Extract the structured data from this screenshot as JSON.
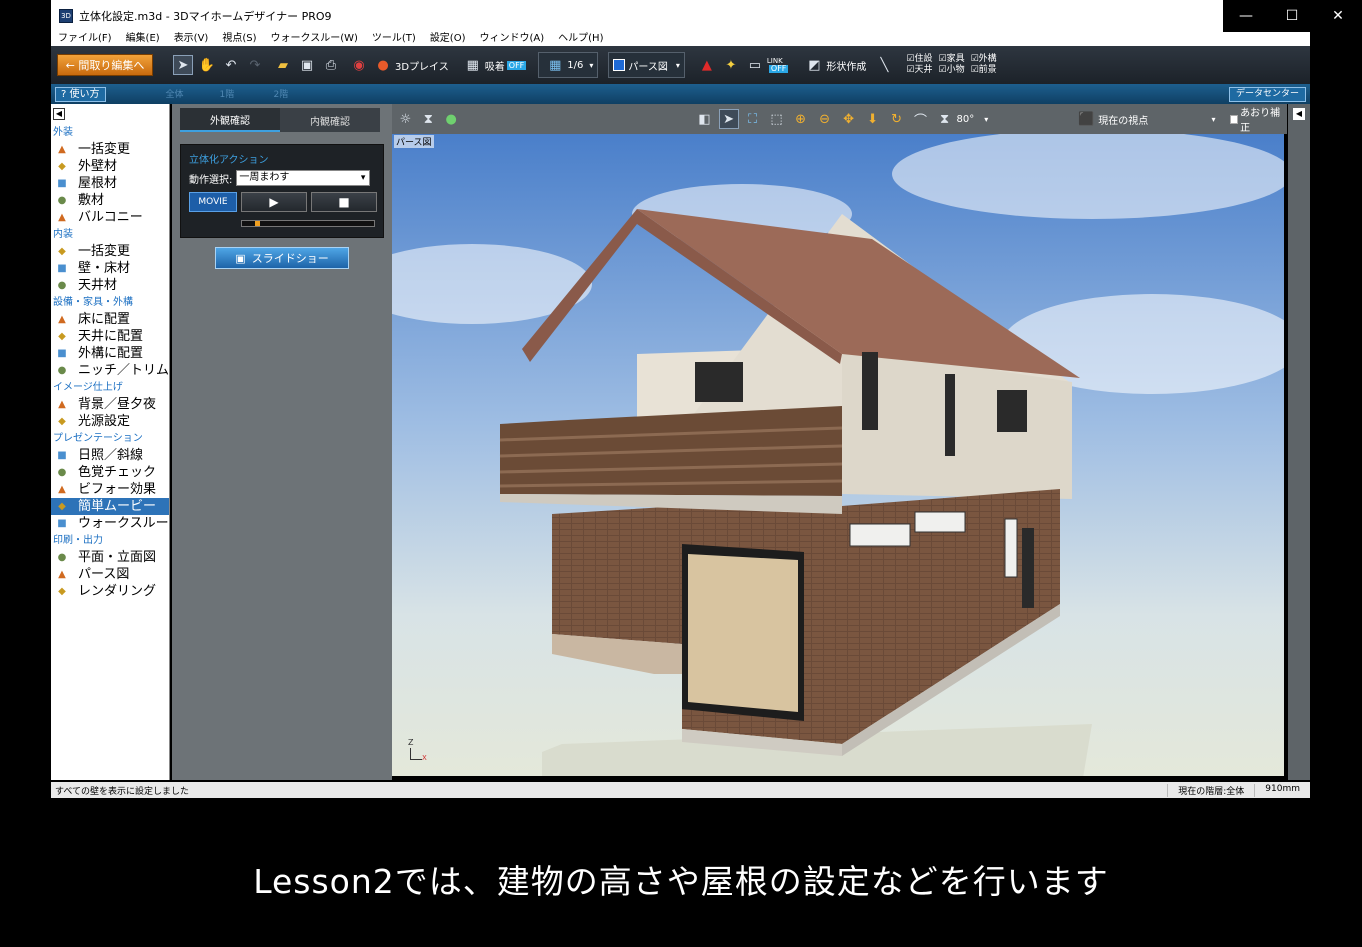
{
  "window": {
    "title": "立体化設定.m3d - 3Dマイホームデザイナー PRO9",
    "minimize": "—",
    "maximize": "☐",
    "close": "✕"
  },
  "menu": [
    "ファイル(F)",
    "編集(E)",
    "表示(V)",
    "視点(S)",
    "ウォークスルー(W)",
    "ツール(T)",
    "設定(O)",
    "ウィンドウ(A)",
    "ヘルプ(H)"
  ],
  "toolbar": {
    "floorplan_edit": "← 間取り編集へ",
    "place_3d": "3Dプレイス",
    "snap": "吸着",
    "snap_state": "OFF",
    "scale": "1/6",
    "view_mode": "パース図",
    "link": "LINK",
    "link_state": "OFF",
    "shape_create": "形状作成",
    "checks": [
      {
        "top": "住設",
        "bottom": "天井"
      },
      {
        "top": "家具",
        "bottom": "小物"
      },
      {
        "top": "外構",
        "bottom": "前景"
      }
    ]
  },
  "subbar": {
    "howto": "? 使い方",
    "ghost_tabs": [
      "全体",
      "1階",
      "2階"
    ],
    "datacenter": "データセンター"
  },
  "sidebar": {
    "sections": [
      {
        "title": "外装",
        "items": [
          "一括変更",
          "外壁材",
          "屋根材",
          "敷材",
          "バルコニー"
        ]
      },
      {
        "title": "内装",
        "items": [
          "一括変更",
          "壁・床材",
          "天井材"
        ]
      },
      {
        "title": "設備・家具・外構",
        "items": [
          "床に配置",
          "天井に配置",
          "外構に配置",
          "ニッチ／トリム"
        ]
      },
      {
        "title": "イメージ仕上げ",
        "items": [
          "背景／昼夕夜",
          "光源設定"
        ]
      },
      {
        "title": "プレゼンテーション",
        "items": [
          "日照／斜線",
          "色覚チェック",
          "ビフォー効果",
          "簡単ムービー",
          "ウォークスルー"
        ]
      },
      {
        "title": "印刷・出力",
        "items": [
          "平面・立面図",
          "パース図",
          "レンダリング"
        ]
      }
    ],
    "active_item": "簡単ムービー"
  },
  "panel": {
    "tab_exterior": "外観確認",
    "tab_interior": "内観確認",
    "action_title": "立体化アクション",
    "action_label": "動作選択:",
    "action_value": "一周まわす",
    "movie_label": "MOVIE",
    "play_symbol": "▶",
    "stop_symbol": "■",
    "progress": 0.1,
    "slideshow": "スライドショー"
  },
  "viewbar": {
    "angle": "80°",
    "viewpoint": "現在の視点",
    "tilt_correct": "あおり補正"
  },
  "viewport": {
    "label": "パース図",
    "axis_z": "Z",
    "axis_x": "X"
  },
  "status": {
    "message": "すべての壁を表示に設定しました",
    "floor": "現在の階層:全体",
    "grid": "910mm"
  },
  "caption": "Lesson2では、建物の高さや屋根の設定などを行います"
}
